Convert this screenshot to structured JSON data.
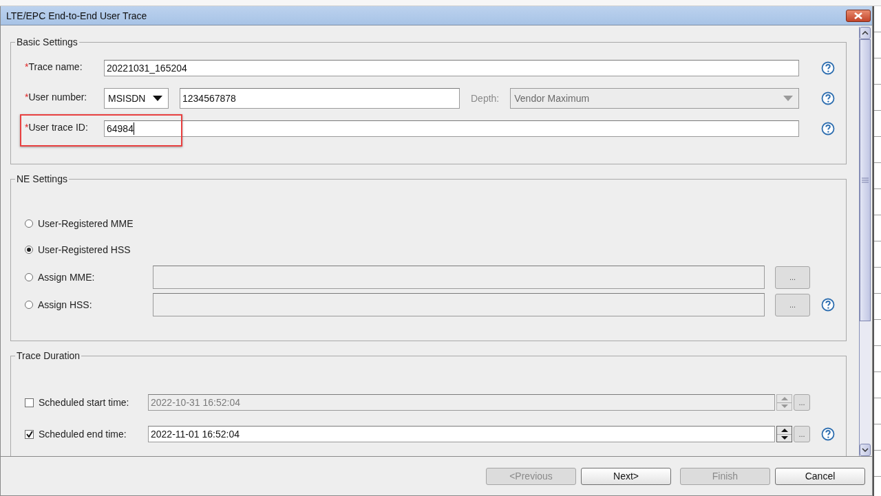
{
  "window": {
    "title": "LTE/EPC End-to-End User Trace"
  },
  "basic_settings": {
    "title": "Basic Settings",
    "fields": [
      {
        "kind": "text",
        "required_mark": "*",
        "label": "Trace name:",
        "value": "20221031_165204",
        "highlighted": false
      },
      {
        "kind": "user_number",
        "required_mark": "*",
        "label": "User number:",
        "type_value": "MSISDN",
        "value": "1234567878",
        "depth_label": "Depth:",
        "depth_value": "Vendor Maximum",
        "depth_disabled": true,
        "highlighted": false
      },
      {
        "kind": "text",
        "required_mark": "*",
        "label": "User trace ID:",
        "value": "64984",
        "highlighted": true
      }
    ]
  },
  "ne_settings": {
    "title": "NE Settings",
    "options": [
      {
        "kind": "radio",
        "label": "User-Registered MME",
        "selected": false
      },
      {
        "kind": "radio",
        "label": "User-Registered HSS",
        "selected": true
      },
      {
        "kind": "radio_field",
        "label": "Assign MME:",
        "selected": false,
        "browse_label": "...",
        "help": false
      },
      {
        "kind": "radio_field",
        "label": "Assign HSS:",
        "selected": false,
        "browse_label": "...",
        "help": true
      }
    ]
  },
  "trace_duration": {
    "title": "Trace Duration",
    "rows": [
      {
        "label": "Scheduled start time:",
        "checked": false,
        "value": "2022-10-31 16:52:04",
        "browse_label": "...",
        "help": false
      },
      {
        "label": "Scheduled end time:",
        "checked": true,
        "value": "2022-11-01 16:52:04",
        "browse_label": "...",
        "help": true
      }
    ]
  },
  "buttons": [
    {
      "label": "<Previous",
      "disabled": true
    },
    {
      "label": "Next>",
      "disabled": false
    },
    {
      "label": "Finish",
      "disabled": true
    },
    {
      "label": "Cancel",
      "disabled": false
    }
  ]
}
